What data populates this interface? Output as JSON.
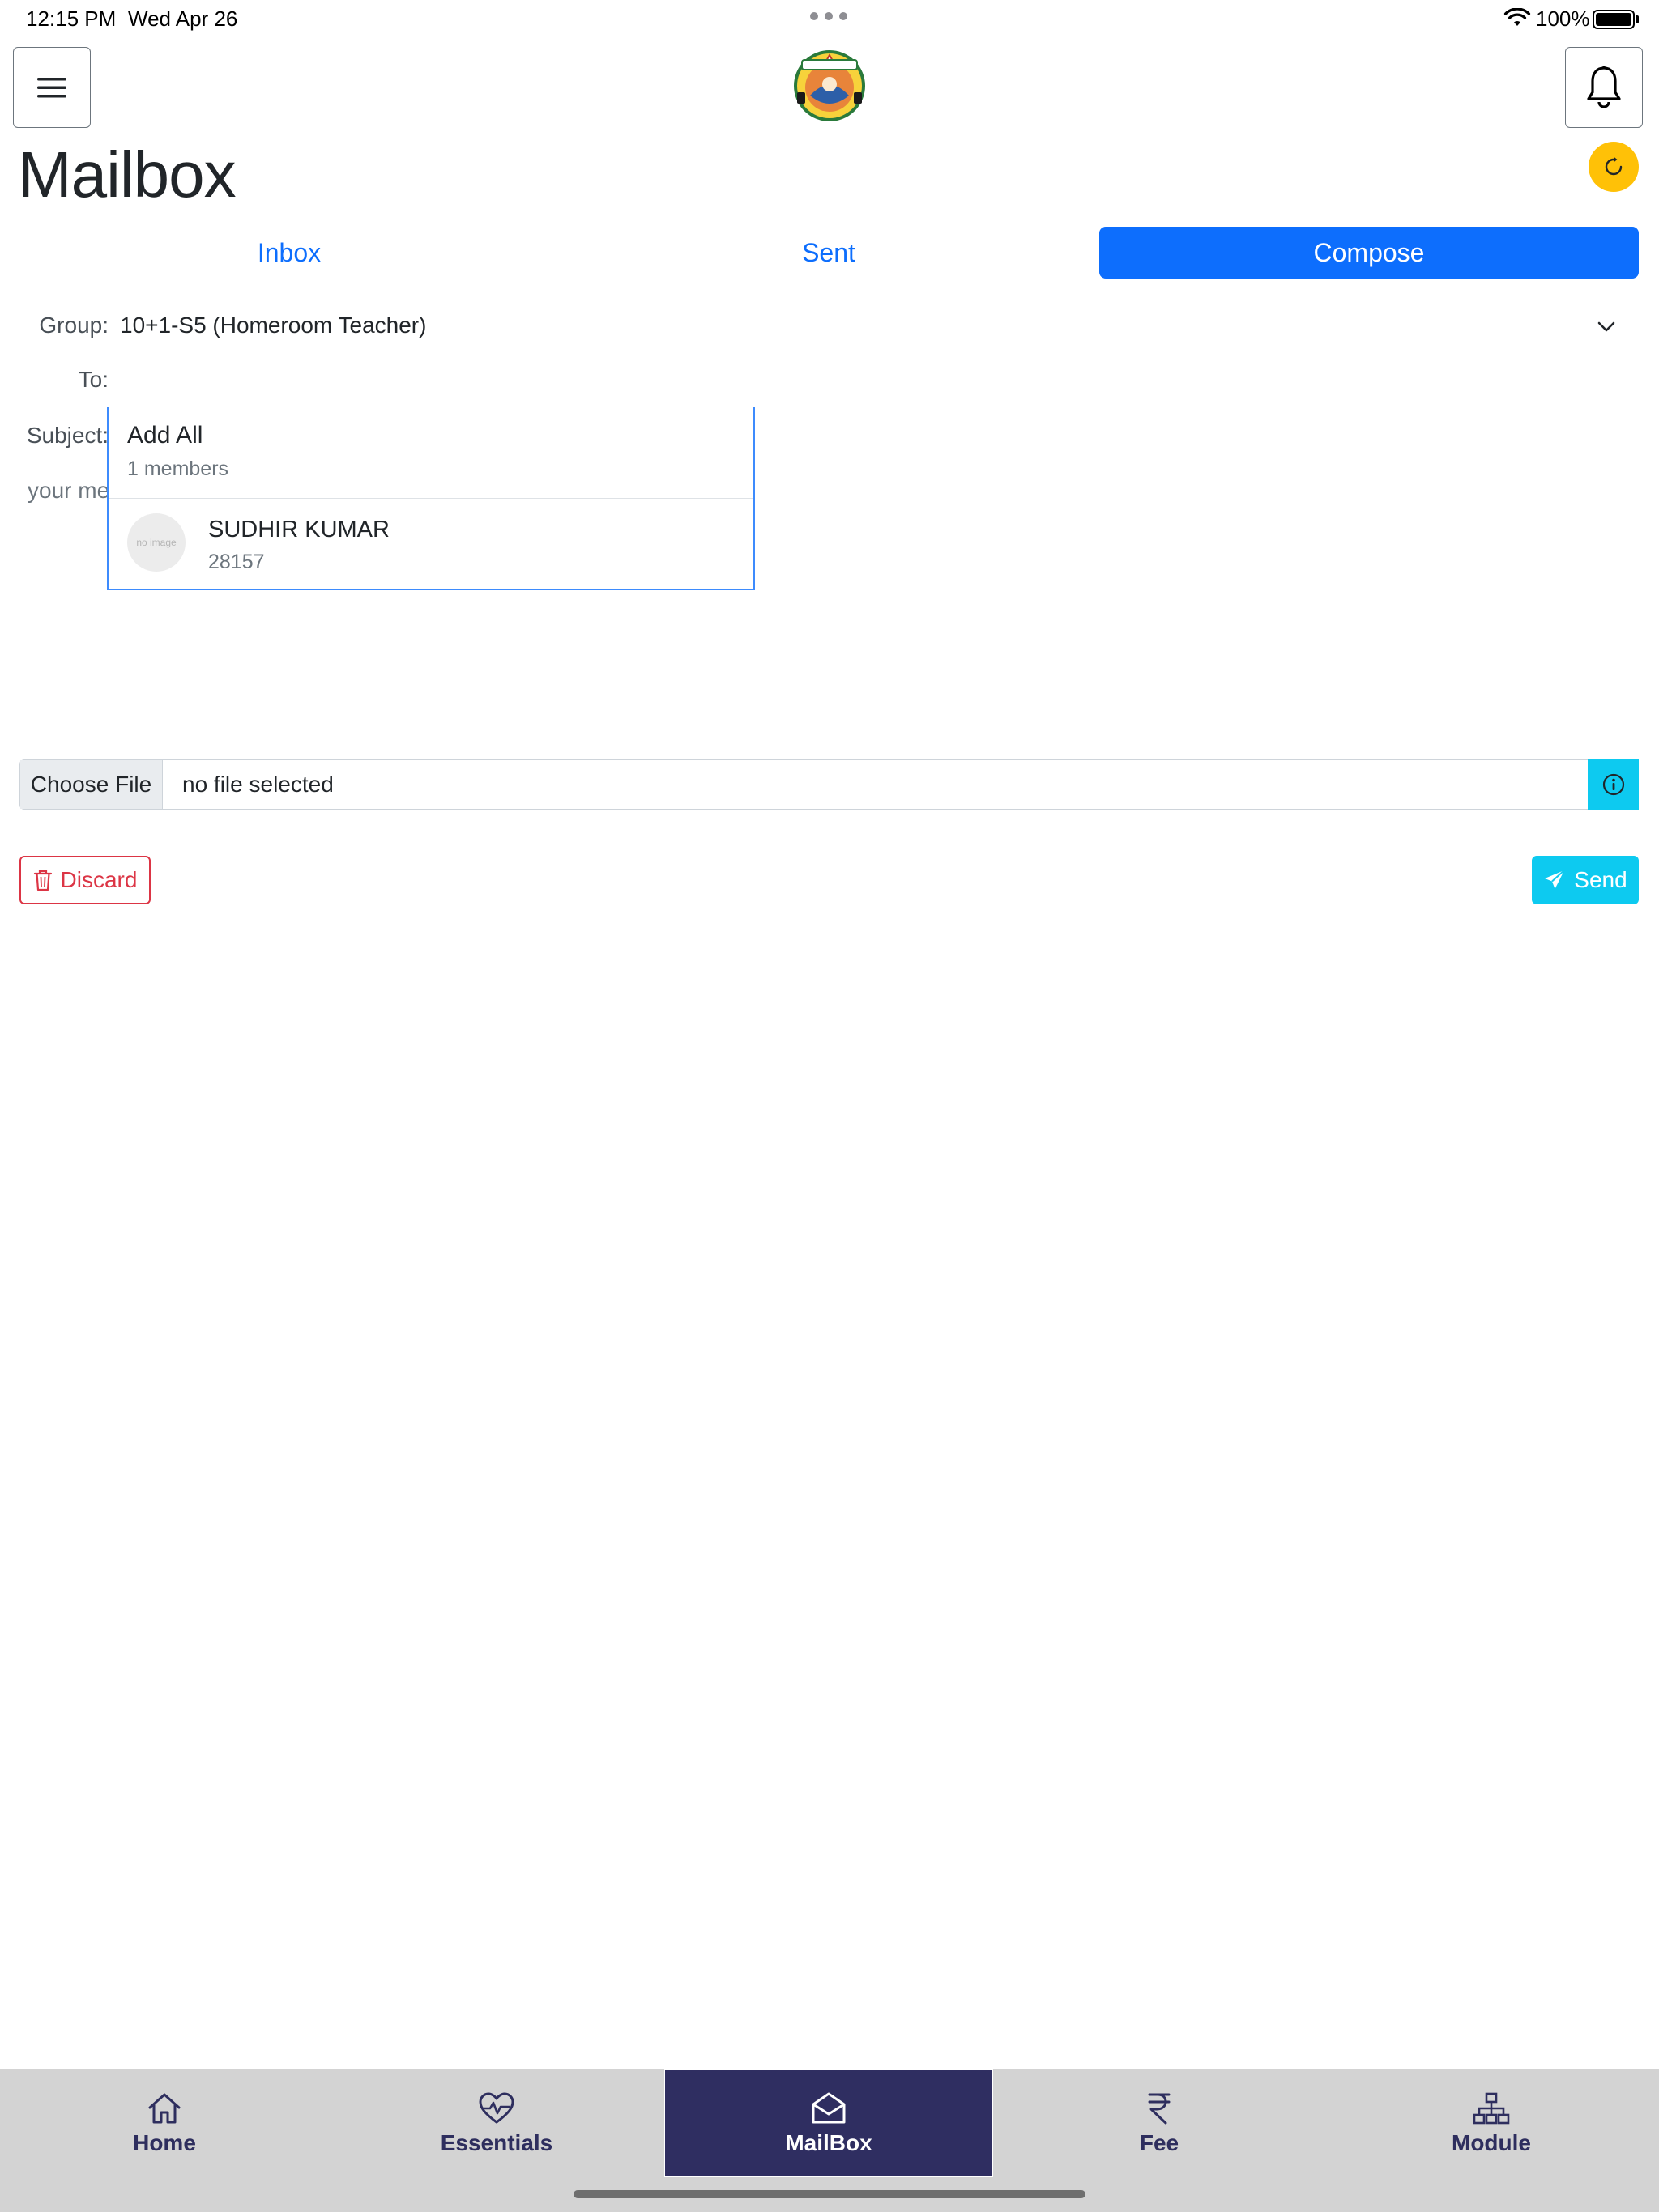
{
  "status_bar": {
    "time": "12:15 PM",
    "date": "Wed Apr 26",
    "battery": "100%"
  },
  "header": {
    "menu_icon": "hamburger-menu-icon",
    "bell_icon": "bell-icon",
    "logo": "school-logo"
  },
  "page": {
    "title": "Mailbox"
  },
  "tabs": [
    {
      "label": "Inbox",
      "active": false
    },
    {
      "label": "Sent",
      "active": false
    },
    {
      "label": "Compose",
      "active": true
    }
  ],
  "form": {
    "group_label": "Group:",
    "group_value": "10+1-S5 (Homeroom Teacher)",
    "to_label": "To:",
    "subject_label": "Subject:",
    "message_placeholder": "your me"
  },
  "dropdown": {
    "add_all_label": "Add All",
    "members_count": "1 members",
    "members": [
      {
        "name": "SUDHIR KUMAR",
        "id": "28157",
        "avatar_text": "no image"
      }
    ]
  },
  "file_input": {
    "choose_label": "Choose File",
    "status": "no file selected"
  },
  "actions": {
    "discard_label": "Discard",
    "send_label": "Send"
  },
  "bottom_nav": [
    {
      "label": "Home",
      "icon": "home-icon",
      "active": false
    },
    {
      "label": "Essentials",
      "icon": "heart-pulse-icon",
      "active": false
    },
    {
      "label": "MailBox",
      "icon": "envelope-open-icon",
      "active": true
    },
    {
      "label": "Fee",
      "icon": "rupee-icon",
      "active": false
    },
    {
      "label": "Module",
      "icon": "sitemap-icon",
      "active": false
    }
  ],
  "colors": {
    "primary": "#0d6efd",
    "info": "#0dcaf0",
    "danger": "#dc3545",
    "warning": "#ffc107",
    "nav_active": "#2f2e61"
  }
}
